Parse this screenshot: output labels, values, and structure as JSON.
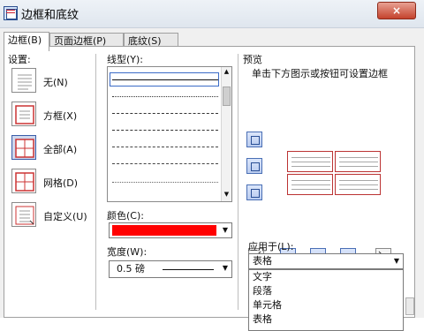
{
  "window": {
    "title": "边框和底纹",
    "close_label": "×"
  },
  "tabs": [
    "边框(B)",
    "页面边框(P)",
    "底纹(S)"
  ],
  "settings": {
    "label": "设置:",
    "options": [
      "无(N)",
      "方框(X)",
      "全部(A)",
      "网格(D)",
      "自定义(U)"
    ]
  },
  "line_style": {
    "label": "线型(Y):"
  },
  "color": {
    "label": "颜色(C):",
    "value": "#ff0000"
  },
  "width": {
    "label": "宽度(W):",
    "value": "0.5 磅"
  },
  "preview": {
    "label": "预览",
    "hint": "单击下方图示或按钮可设置边框"
  },
  "apply_to": {
    "label": "应用于(L):",
    "value": "表格",
    "options": [
      "文字",
      "段落",
      "单元格",
      "表格"
    ]
  }
}
